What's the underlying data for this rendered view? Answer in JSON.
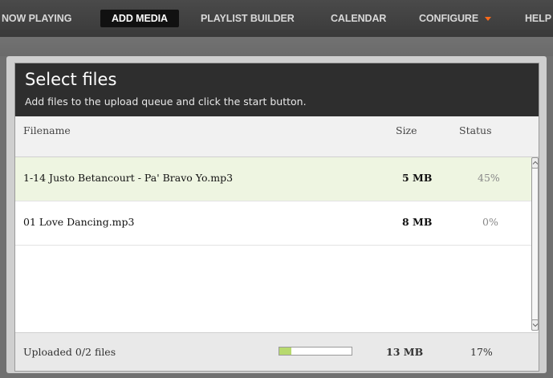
{
  "nav": {
    "items": [
      {
        "label": "NOW PLAYING"
      },
      {
        "label": "ADD MEDIA"
      },
      {
        "label": "PLAYLIST BUILDER"
      },
      {
        "label": "CALENDAR"
      },
      {
        "label": "CONFIGURE"
      },
      {
        "label": "HELP"
      }
    ],
    "active": "ADD MEDIA",
    "configure_caret_color": "#ff6a1a"
  },
  "uploader": {
    "title": "Select files",
    "subtitle": "Add files to the upload queue and click the start button.",
    "columns": {
      "filename": "Filename",
      "size": "Size",
      "status": "Status"
    },
    "files": [
      {
        "name": "1-14 Justo Betancourt - Pa' Bravo Yo.mp3",
        "size": "5 MB",
        "status": "45%"
      },
      {
        "name": "01 Love Dancing.mp3",
        "size": "8 MB",
        "status": "0%"
      }
    ],
    "footer": {
      "uploaded_text": "Uploaded 0/2 files",
      "total_size": "13 MB",
      "total_percent": "17%",
      "progress_fraction": 0.17
    }
  },
  "colors": {
    "active_row": "#eef5e1",
    "progress_fill": "#b7d96e",
    "header_bg": "#2e2e2e"
  }
}
